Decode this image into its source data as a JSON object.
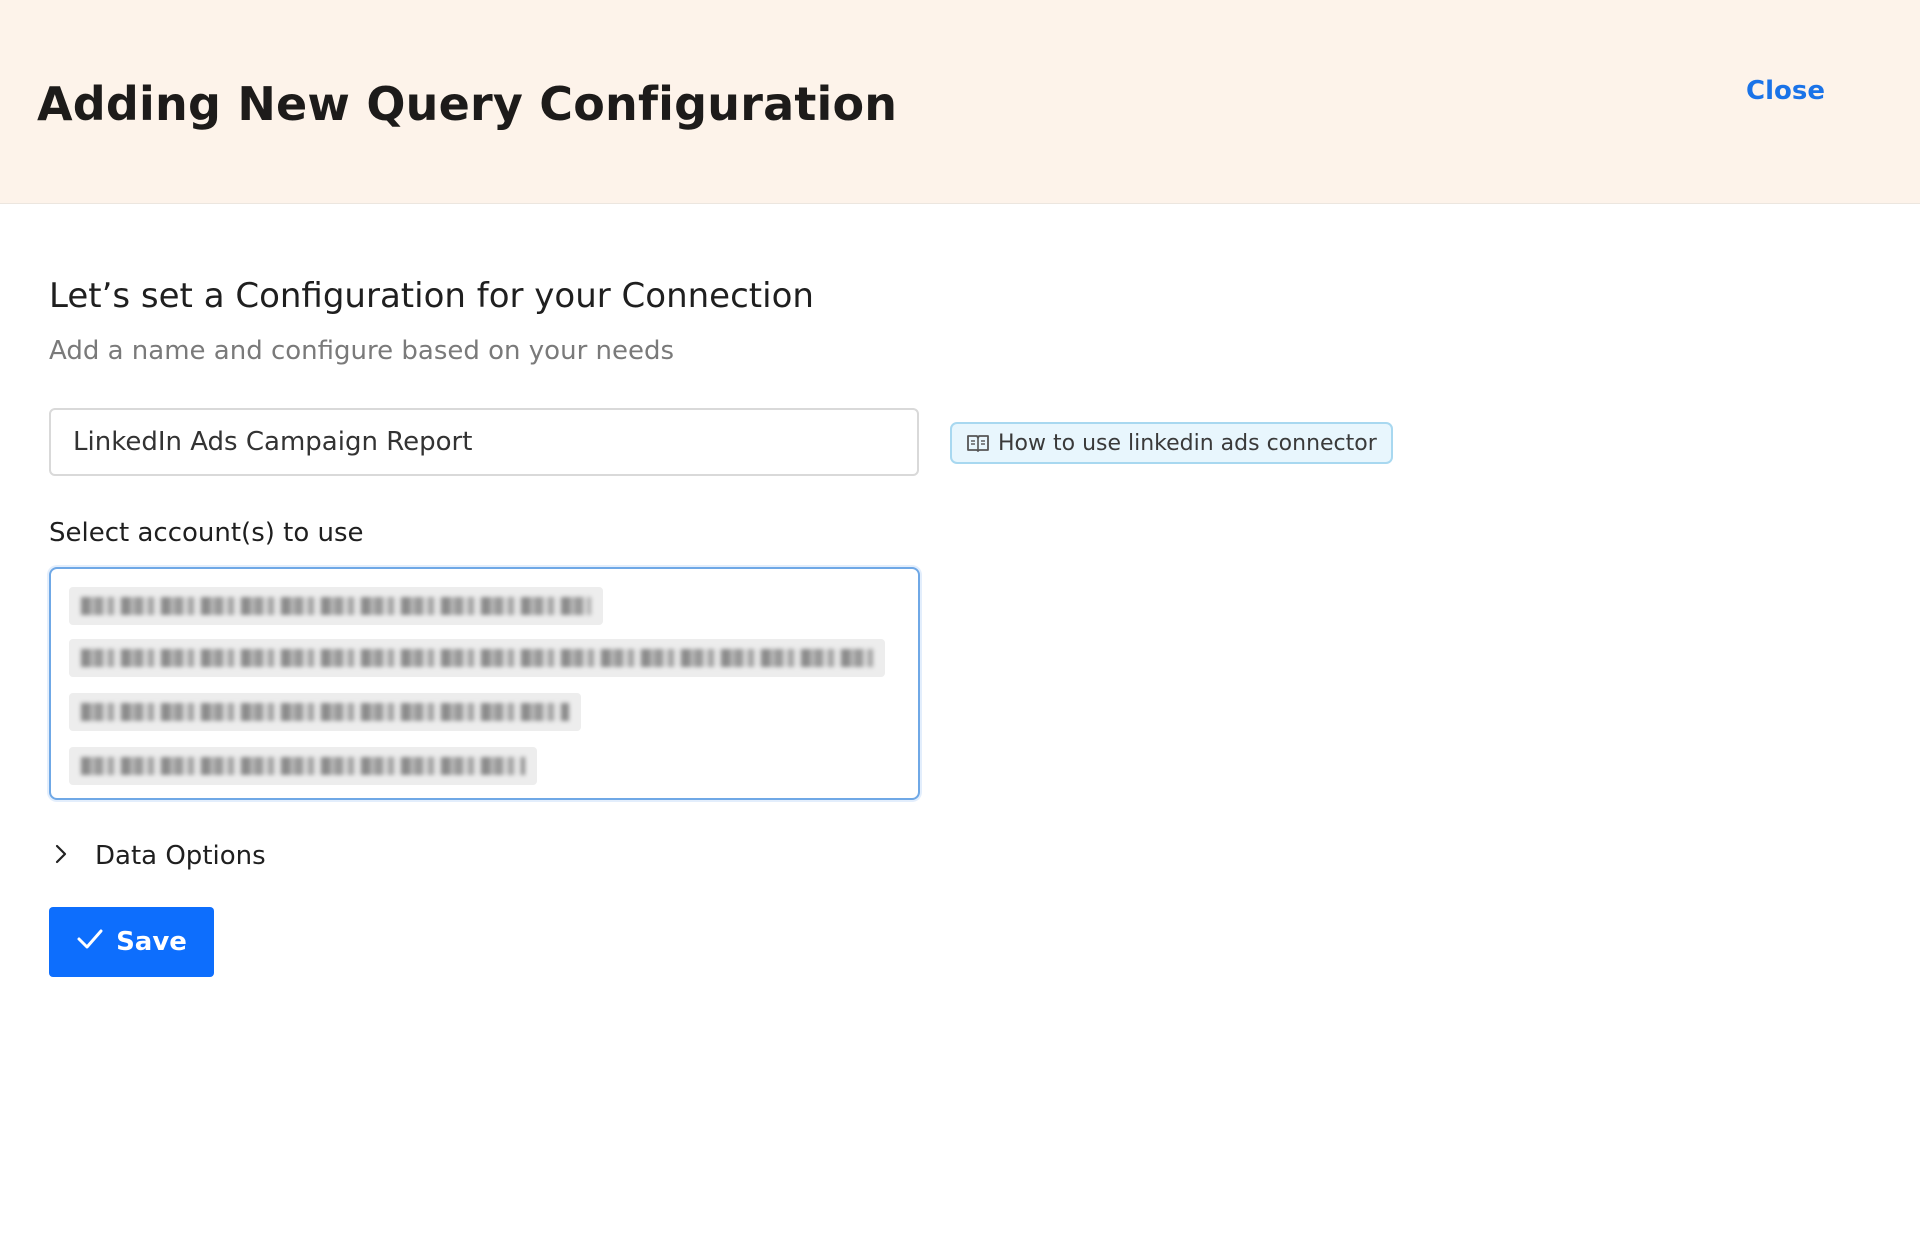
{
  "header": {
    "title": "Adding New Query Configuration",
    "close_label": "Close"
  },
  "section": {
    "title": "Let’s set a Configuration for your Connection",
    "subtitle": "Add a name and configure based on your needs"
  },
  "config_name": {
    "value": "LinkedIn Ads Campaign Report"
  },
  "help": {
    "label": "How to use linkedin ads connector",
    "icon": "book-open-icon"
  },
  "accounts": {
    "label": "Select account(s) to use",
    "selected_count": 4
  },
  "data_options": {
    "label": "Data Options",
    "icon": "chevron-right-icon",
    "expanded": false
  },
  "save": {
    "label": "Save",
    "icon": "checkmark-icon"
  },
  "colors": {
    "header_bg": "#fdf3ea",
    "accent": "#0d6efd",
    "link": "#1a73e8",
    "help_bg": "#e8f6fd",
    "help_border": "#a8d8f0"
  }
}
